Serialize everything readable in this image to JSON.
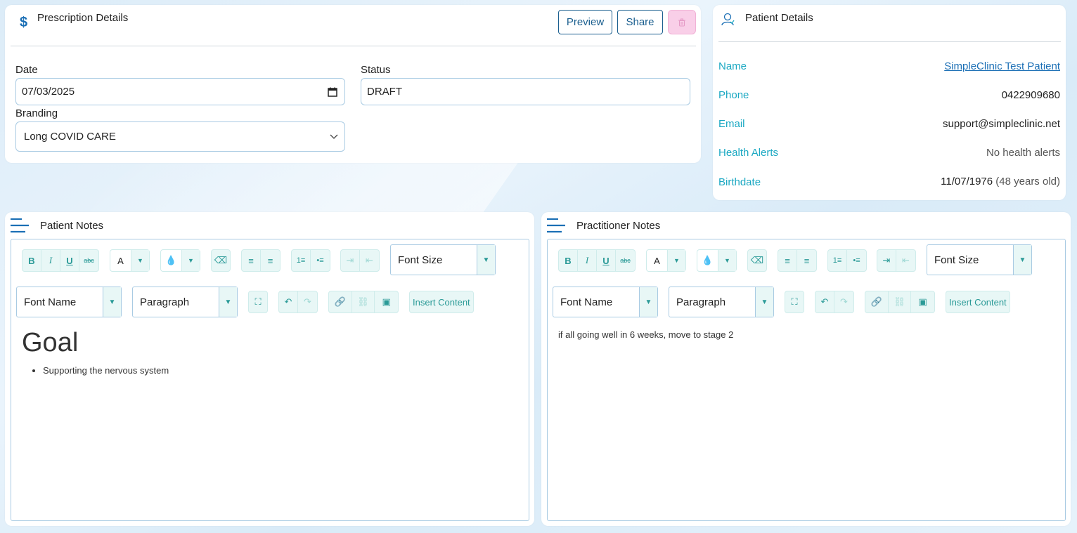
{
  "prescription": {
    "title": "Prescription Details",
    "preview_label": "Preview",
    "share_label": "Share",
    "date_label": "Date",
    "date_value": "07/03/2025",
    "status_label": "Status",
    "status_value": "DRAFT",
    "branding_label": "Branding",
    "branding_value": "Long COVID CARE"
  },
  "patient": {
    "title": "Patient Details",
    "name_label": "Name",
    "name_value": "SimpleClinic Test Patient",
    "phone_label": "Phone",
    "phone_value": "0422909680",
    "email_label": "Email",
    "email_value": "support@simpleclinic.net",
    "alerts_label": "Health Alerts",
    "alerts_value": "No health alerts",
    "birthdate_label": "Birthdate",
    "birthdate_value": "11/07/1976",
    "age_value": "(48 years old)"
  },
  "patient_notes": {
    "title": "Patient Notes",
    "font_size_label": "Font Size",
    "font_name_label": "Font Name",
    "paragraph_label": "Paragraph",
    "insert_label": "Insert Content",
    "heading": "Goal",
    "bullets": [
      "Supporting the nervous system"
    ]
  },
  "practitioner_notes": {
    "title": "Practitioner Notes",
    "font_size_label": "Font Size",
    "font_name_label": "Font Name",
    "paragraph_label": "Paragraph",
    "insert_label": "Insert Content",
    "text": "if all going well in 6 weeks, move to stage 2"
  },
  "colors": {
    "brand": "#1b6fb5",
    "accent": "#1aa8c2",
    "toolbar": "#e8f7f6",
    "delete": "#f9cfe8"
  }
}
